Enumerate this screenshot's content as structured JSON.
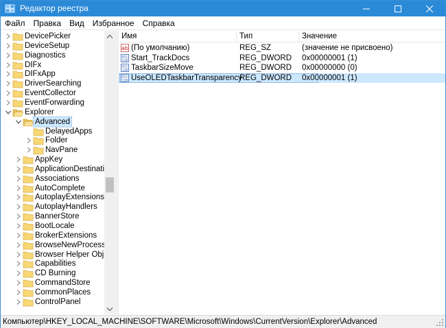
{
  "window": {
    "title": "Редактор реестра",
    "accent": "#2b8ad8",
    "selection_color": "#cce8ff"
  },
  "menu": [
    "Файл",
    "Правка",
    "Вид",
    "Избранное",
    "Справка"
  ],
  "tree": {
    "items": [
      {
        "label": "DevicePicker",
        "level": 1,
        "expander": "collapsed",
        "icon": "folder-icon"
      },
      {
        "label": "DeviceSetup",
        "level": 1,
        "expander": "collapsed",
        "icon": "folder-icon"
      },
      {
        "label": "Diagnostics",
        "level": 1,
        "expander": "collapsed",
        "icon": "folder-icon"
      },
      {
        "label": "DIFx",
        "level": 1,
        "expander": "collapsed",
        "icon": "folder-icon"
      },
      {
        "label": "DIFxApp",
        "level": 1,
        "expander": "collapsed",
        "icon": "folder-icon"
      },
      {
        "label": "DriverSearching",
        "level": 1,
        "expander": "collapsed",
        "icon": "folder-icon"
      },
      {
        "label": "EventCollector",
        "level": 1,
        "expander": "collapsed",
        "icon": "folder-icon"
      },
      {
        "label": "EventForwarding",
        "level": 1,
        "expander": "collapsed",
        "icon": "folder-icon"
      },
      {
        "label": "Explorer",
        "level": 1,
        "expander": "expanded",
        "icon": "folder-open-icon"
      },
      {
        "label": "Advanced",
        "level": 2,
        "expander": "expanded",
        "icon": "folder-open-icon",
        "selected": true
      },
      {
        "label": "DelayedApps",
        "level": 3,
        "expander": "none",
        "icon": "folder-icon"
      },
      {
        "label": "Folder",
        "level": 3,
        "expander": "collapsed",
        "icon": "folder-icon"
      },
      {
        "label": "NavPane",
        "level": 3,
        "expander": "collapsed",
        "icon": "folder-icon"
      },
      {
        "label": "AppKey",
        "level": 2,
        "expander": "collapsed",
        "icon": "folder-icon"
      },
      {
        "label": "ApplicationDestinations",
        "level": 2,
        "expander": "collapsed",
        "icon": "folder-icon"
      },
      {
        "label": "Associations",
        "level": 2,
        "expander": "collapsed",
        "icon": "folder-icon"
      },
      {
        "label": "AutoComplete",
        "level": 2,
        "expander": "collapsed",
        "icon": "folder-icon"
      },
      {
        "label": "AutoplayExtensions",
        "level": 2,
        "expander": "collapsed",
        "icon": "folder-icon"
      },
      {
        "label": "AutoplayHandlers",
        "level": 2,
        "expander": "collapsed",
        "icon": "folder-icon"
      },
      {
        "label": "BannerStore",
        "level": 2,
        "expander": "collapsed",
        "icon": "folder-icon"
      },
      {
        "label": "BootLocale",
        "level": 2,
        "expander": "collapsed",
        "icon": "folder-icon"
      },
      {
        "label": "BrokerExtensions",
        "level": 2,
        "expander": "collapsed",
        "icon": "folder-icon"
      },
      {
        "label": "BrowseNewProcess",
        "level": 2,
        "expander": "collapsed",
        "icon": "folder-icon"
      },
      {
        "label": "Browser Helper Objects",
        "level": 2,
        "expander": "collapsed",
        "icon": "folder-icon"
      },
      {
        "label": "Capabilities",
        "level": 2,
        "expander": "collapsed",
        "icon": "folder-icon"
      },
      {
        "label": "CD Burning",
        "level": 2,
        "expander": "collapsed",
        "icon": "folder-icon"
      },
      {
        "label": "CommandStore",
        "level": 2,
        "expander": "collapsed",
        "icon": "folder-icon"
      },
      {
        "label": "CommonPlaces",
        "level": 2,
        "expander": "collapsed",
        "icon": "folder-icon"
      },
      {
        "label": "ControlPanel",
        "level": 2,
        "expander": "collapsed",
        "icon": "folder-icon"
      }
    ]
  },
  "list": {
    "columns": [
      "Имя",
      "Тип",
      "Значение"
    ],
    "rows": [
      {
        "name": "(По умолчанию)",
        "type": "REG_SZ",
        "value": "(значение не присвоено)",
        "icon": "string-value-icon"
      },
      {
        "name": "Start_TrackDocs",
        "type": "REG_DWORD",
        "value": "0x00000001 (1)",
        "icon": "binary-value-icon"
      },
      {
        "name": "TaskbarSizeMove",
        "type": "REG_DWORD",
        "value": "0x00000000 (0)",
        "icon": "binary-value-icon"
      },
      {
        "name": "UseOLEDTaskbarTransparency",
        "type": "REG_DWORD",
        "value": "0x00000001 (1)",
        "icon": "binary-value-icon",
        "selected": true
      }
    ]
  },
  "status": {
    "path": "Компьютер\\HKEY_LOCAL_MACHINE\\SOFTWARE\\Microsoft\\Windows\\CurrentVersion\\Explorer\\Advanced"
  }
}
